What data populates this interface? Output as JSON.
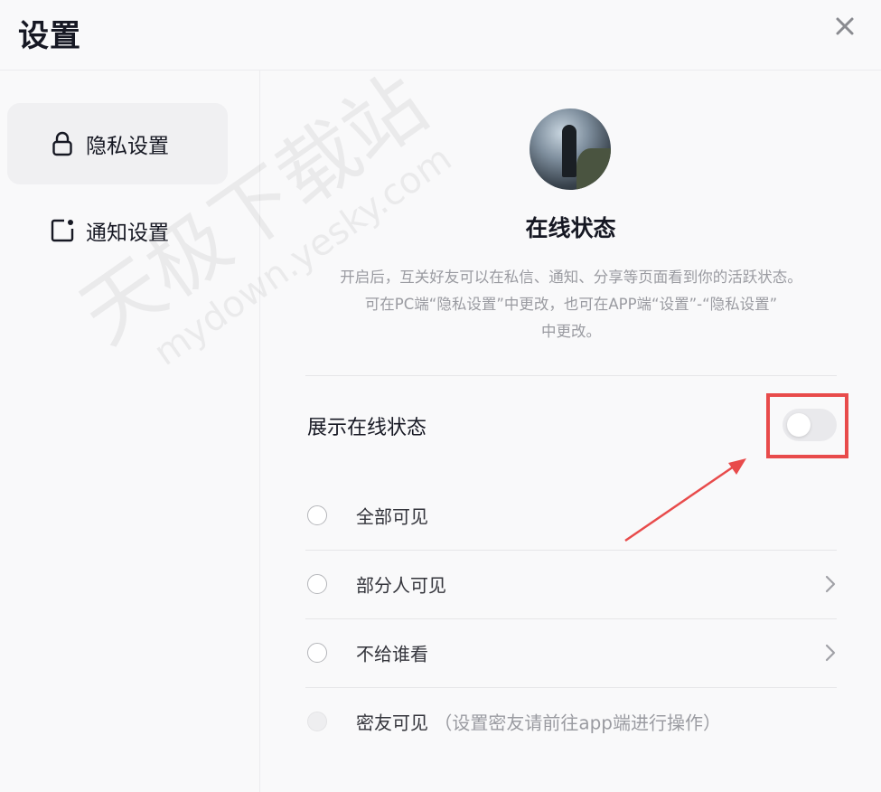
{
  "header": {
    "title": "设置"
  },
  "sidebar": {
    "items": [
      {
        "label": "隐私设置",
        "icon": "lock-icon",
        "active": true
      },
      {
        "label": "通知设置",
        "icon": "notification-icon",
        "active": false
      }
    ]
  },
  "main": {
    "avatar_icon": "user-avatar",
    "title": "在线状态",
    "description": [
      "开启后，互关好友可以在私信、通知、分享等页面看到你的活跃状态。",
      "可在PC端“隐私设置”中更改，也可在APP端“设置”-“隐私设置”",
      "中更改。"
    ],
    "toggle": {
      "label": "展示在线状态",
      "enabled": false
    },
    "options": [
      {
        "label": "全部可见",
        "note": "",
        "has_chevron": false,
        "disabled": false
      },
      {
        "label": "部分人可见",
        "note": "",
        "has_chevron": true,
        "disabled": false
      },
      {
        "label": "不给谁看",
        "note": "",
        "has_chevron": true,
        "disabled": false
      },
      {
        "label": "密友可见",
        "note": "（设置密友请前往app端进行操作）",
        "has_chevron": false,
        "disabled": true
      }
    ]
  },
  "watermark": {
    "cn": "天极下载站",
    "en": "mydown.yesky.com"
  },
  "colors": {
    "annotation_red": "#e84b4b",
    "muted_text": "#9a9ba1",
    "primary_text": "#161823"
  }
}
